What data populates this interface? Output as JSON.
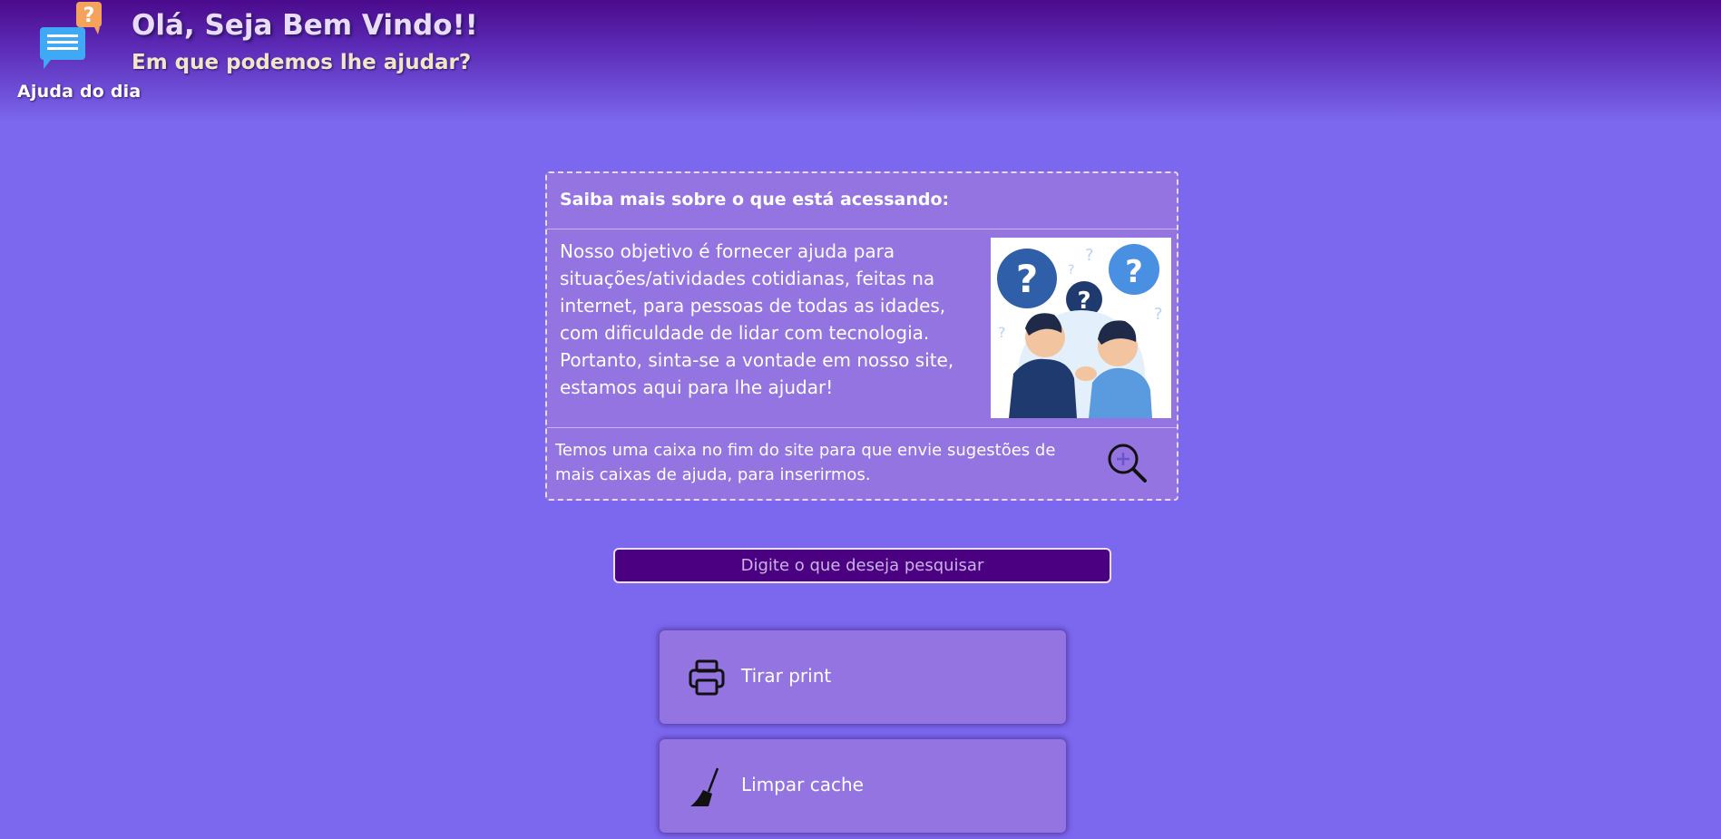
{
  "header": {
    "title": "Olá, Seja Bem Vindo!!",
    "subtitle": "Em que podemos lhe ajudar?",
    "logo_caption": "Ajuda do dia"
  },
  "info": {
    "heading": "Saiba mais sobre o que está acessando:",
    "body": "Nosso objetivo é fornecer ajuda para situações/atividades cotidianas, feitas na internet, para pessoas de todas as idades, com dificuldade de lidar com tecnologia. Portanto, sinta-se a vontade em nosso site, estamos aqui para lhe ajudar!",
    "footer": "Temos uma caixa no fim do site para que envie sugestões de mais caixas de ajuda, para inserirmos."
  },
  "search": {
    "placeholder": "Digite o que deseja pesquisar"
  },
  "actions": [
    {
      "label": "Tirar print",
      "icon": "printer-icon"
    },
    {
      "label": "Limpar cache",
      "icon": "broom-icon"
    }
  ],
  "colors": {
    "background": "#7b68ee",
    "header_dark": "#4b0a8c",
    "card": "#9374e0",
    "search_bg": "#4b0082"
  }
}
